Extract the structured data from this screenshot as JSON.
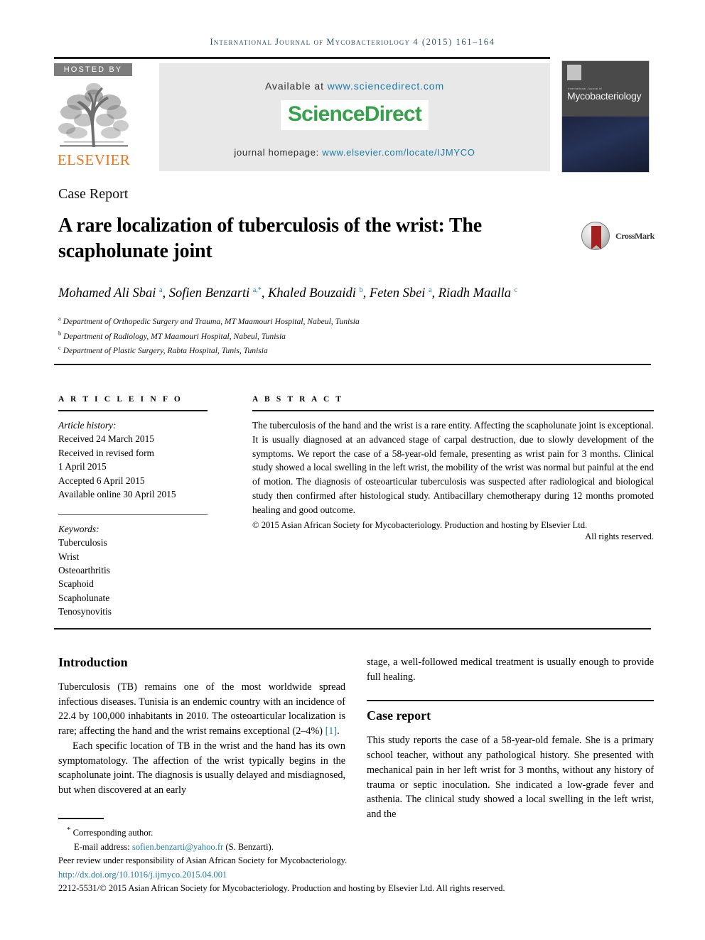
{
  "running_head": {
    "journal": "International Journal of Mycobacteriology",
    "volume_info": "4 (2015) 161–164"
  },
  "masthead": {
    "hosted_by": "HOSTED BY",
    "publisher": "ELSEVIER",
    "available_prefix": "Available at ",
    "available_url": "www.sciencedirect.com",
    "sciencedirect_logo": "ScienceDirect",
    "homepage_prefix": "journal homepage: ",
    "homepage_url": "www.elsevier.com/locate/IJMYCO",
    "cover": {
      "supertitle": "International Journal of",
      "title": "Mycobacteriology"
    },
    "colors": {
      "link": "#1b7ba8",
      "sciencedirect_green": "#35a14a",
      "elsevier_orange": "#e87722",
      "panel_gray": "#e8e8e8",
      "hosted_gray": "#7d7d7d"
    }
  },
  "article": {
    "type_label": "Case Report",
    "title": "A rare localization of tuberculosis of the wrist: The scapholunate joint",
    "crossmark_label": "CrossMark",
    "authors_html": "Mohamed Ali Sbai <sup>a</sup>, Sofien Benzarti <sup>a,*</sup>, Khaled Bouzaidi <sup>b</sup>, Feten Sbei <sup>a</sup>, Riadh Maalla <sup>c</sup>",
    "affiliations": [
      {
        "marker": "a",
        "text": "Department of Orthopedic Surgery and Trauma, MT Maamouri Hospital, Nabeul, Tunisia"
      },
      {
        "marker": "b",
        "text": "Department of Radiology, MT Maamouri Hospital, Nabeul, Tunisia"
      },
      {
        "marker": "c",
        "text": "Department of Plastic Surgery, Rabta Hospital, Tunis, Tunisia"
      }
    ]
  },
  "article_info": {
    "heading": "A R T I C L E  I N F O",
    "history_label": "Article history:",
    "history": [
      "Received 24 March 2015",
      "Received in revised form",
      "1 April 2015",
      "Accepted 6 April 2015",
      "Available online 30 April 2015"
    ],
    "keywords_label": "Keywords:",
    "keywords": [
      "Tuberculosis",
      "Wrist",
      "Osteoarthritis",
      "Scaphoid",
      "Scapholunate",
      "Tenosynovitis"
    ]
  },
  "abstract": {
    "heading": "A B S T R A C T",
    "text": "The tuberculosis of the hand and the wrist is a rare entity. Affecting the scapholunate joint is exceptional. It is usually diagnosed at an advanced stage of carpal destruction, due to slowly development of the symptoms. We report the case of a 58-year-old female, presenting as wrist pain for 3 months. Clinical study showed a local swelling in the left wrist, the mobility of the wrist was normal but painful at the end of motion. The diagnosis of osteoarticular tuberculosis was suspected after radiological and biological study then confirmed after histological study. Antibacillary chemotherapy during 12 months promoted healing and good outcome.",
    "copyright": "© 2015 Asian African Society for Mycobacteriology. Production and hosting by Elsevier Ltd.",
    "rights": "All rights reserved."
  },
  "body": {
    "left_column": {
      "section_title": "Introduction",
      "paragraph_1_a": "Tuberculosis (TB) remains one of the most worldwide spread infectious diseases. Tunisia is an endemic country with an incidence of 22.4 by 100,000 inhabitants in 2010. The osteoarticular localization is rare; affecting the hand and the wrist remains exceptional (2–4%) ",
      "paragraph_1_ref": "[1]",
      "paragraph_1_b": ".",
      "paragraph_2": "Each specific location of TB in the wrist and the hand has its own symptomatology. The affection of the wrist typically begins in the scapholunate joint. The diagnosis is usually delayed and misdiagnosed, but when discovered at an early"
    },
    "right_column": {
      "continuation": "stage, a well-followed medical treatment is usually enough to provide full healing.",
      "section_title": "Case report",
      "paragraph_1": "This study reports the case of a 58-year-old female. She is a primary school teacher, without any pathological history. She presented with mechanical pain in her left wrist for 3 months, without any history of trauma or septic inoculation. She indicated a low-grade fever and asthenia. The clinical study showed a local swelling in the left wrist, and the"
    }
  },
  "footnotes": {
    "corresponding_author": "Corresponding author.",
    "email_label": "E-mail address: ",
    "email": "sofien.benzarti@yahoo.fr",
    "email_suffix": " (S. Benzarti).",
    "peer_review": "Peer review under responsibility of Asian African Society for Mycobacteriology.",
    "doi": "http://dx.doi.org/10.1016/j.ijmyco.2015.04.001",
    "issn_line": "2212-5531/© 2015 Asian African Society for Mycobacteriology. Production and hosting by Elsevier Ltd. All rights reserved."
  }
}
